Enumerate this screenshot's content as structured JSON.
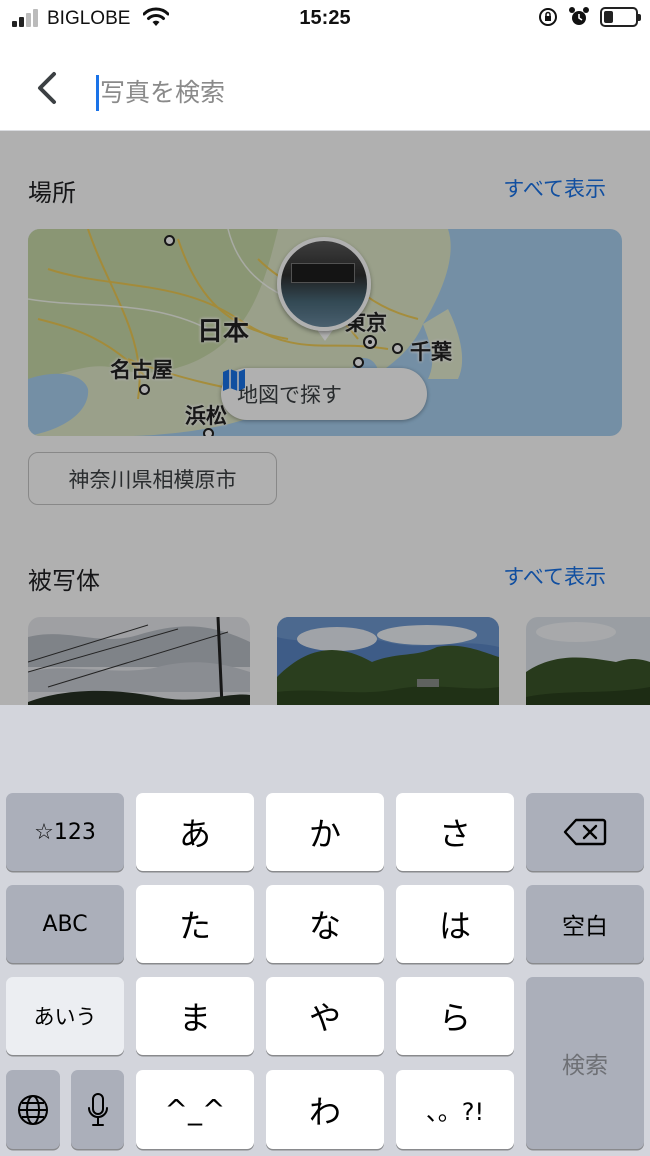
{
  "status_bar": {
    "carrier": "BIGLOBE",
    "time": "15:25"
  },
  "search": {
    "placeholder": "写真を検索",
    "value": ""
  },
  "places": {
    "title": "場所",
    "see_all": "すべて表示",
    "map_labels": {
      "japan": "日本",
      "nagoya": "名古屋",
      "tokyo": "東京",
      "chiba": "千葉",
      "hamamatsu": "浜松"
    },
    "map_button": "地図で探す",
    "chip": "神奈川県相模原市"
  },
  "subjects": {
    "title": "被写体",
    "see_all": "すべて表示"
  },
  "keyboard": {
    "row1": {
      "mode": "☆123",
      "k1": "あ",
      "k2": "か",
      "k3": "さ"
    },
    "row2": {
      "mode": "ABC",
      "k1": "た",
      "k2": "な",
      "k3": "は",
      "space": "空白"
    },
    "row3": {
      "mode": "あいう",
      "k1": "ま",
      "k2": "や",
      "k3": "ら",
      "search": "検索"
    },
    "row4": {
      "k1": "^_^",
      "k2": "わ",
      "k3": "、。?!"
    }
  },
  "colors": {
    "accent": "#1a73e8",
    "keyboard_bg": "#d3d5dc",
    "key_light": "#ffffff",
    "key_dark": "#abafba"
  }
}
